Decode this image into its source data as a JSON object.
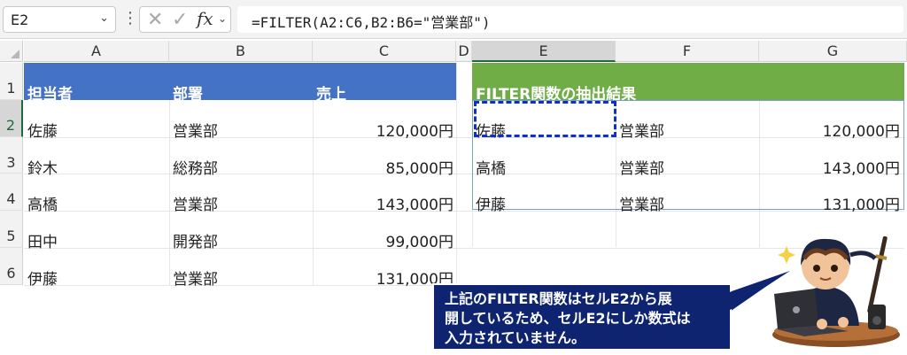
{
  "formula_bar": {
    "name_box": "E2",
    "formula": "=FILTER(A2:C6,B2:B6=\"営業部\")",
    "cancel_glyph": "✕",
    "enter_glyph": "✓",
    "fx_label": "fx"
  },
  "columns": [
    "A",
    "B",
    "C",
    "D",
    "E",
    "F",
    "G"
  ],
  "rows": [
    "1",
    "2",
    "3",
    "4",
    "5",
    "6"
  ],
  "source_table": {
    "headers": [
      "担当者",
      "部署",
      "売上"
    ],
    "rows": [
      [
        "佐藤",
        "営業部",
        "120,000円"
      ],
      [
        "鈴木",
        "総務部",
        "85,000円"
      ],
      [
        "高橋",
        "営業部",
        "143,000円"
      ],
      [
        "田中",
        "開発部",
        "99,000円"
      ],
      [
        "伊藤",
        "営業部",
        "131,000円"
      ]
    ]
  },
  "result_table": {
    "title": "FILTER関数の抽出結果",
    "rows": [
      [
        "佐藤",
        "営業部",
        "120,000円"
      ],
      [
        "高橋",
        "営業部",
        "143,000円"
      ],
      [
        "伊藤",
        "営業部",
        "131,000円"
      ]
    ]
  },
  "callout": {
    "line1": "上記のFILTER関数はセルE2から展",
    "line2": "開しているため、セルE2にしか数式は",
    "line3": "入力されていません。"
  },
  "colors": {
    "source_header": "#4472c4",
    "result_header": "#70ad47",
    "callout_bg": "#0f2470",
    "active_border": "#0b2fd0",
    "selection": "#1c6b3d"
  }
}
